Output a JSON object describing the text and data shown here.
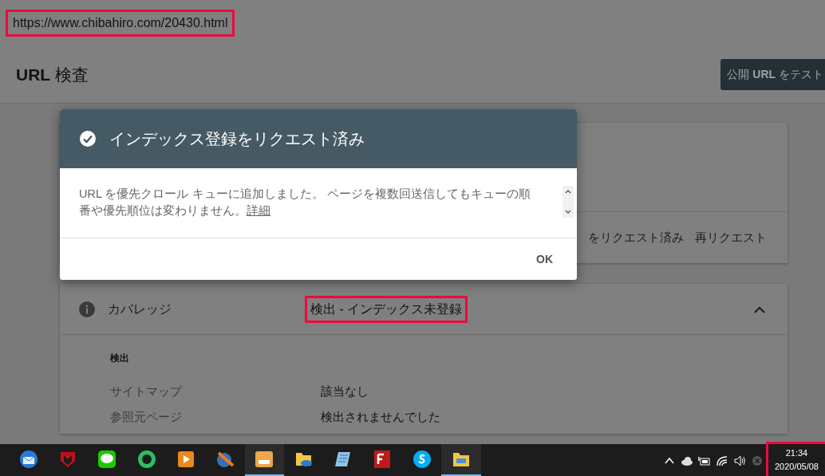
{
  "address_bar": {
    "url": "https://www.chibahiro.com/20430.html",
    "highlighted": true
  },
  "header": {
    "title": "**URL** 検査",
    "test_button": "公開 **URL** をテスト"
  },
  "request_card": {
    "status": "をリクエスト済み",
    "request_again": "再リクエスト"
  },
  "coverage": {
    "label": "カバレッジ",
    "value": "検出 - インデックス未登録",
    "value_highlighted": true,
    "expanded": true,
    "section": "検出",
    "rows": [
      {
        "label": "サイトマップ",
        "value": "該当なし"
      },
      {
        "label": "参照元ページ",
        "value": "検出されませんでした"
      }
    ]
  },
  "dialog": {
    "title": "インデックス登録をリクエスト済み",
    "message": "URL を優先クロール キューに追加しました。 ページを複数回送信してもキューの順番や優先順位は変わりません。",
    "link": "詳細",
    "button": "OK"
  },
  "taskbar": {
    "apps": [
      {
        "kind": "mail",
        "active": false
      },
      {
        "kind": "shield",
        "active": false
      },
      {
        "kind": "chat",
        "active": false
      },
      {
        "kind": "note",
        "active": false
      },
      {
        "kind": "player",
        "active": false
      },
      {
        "kind": "film",
        "active": false
      },
      {
        "kind": "face",
        "active": true
      },
      {
        "kind": "cloud-folder",
        "active": false
      },
      {
        "kind": "notepad",
        "active": false
      },
      {
        "kind": "ftp",
        "active": false
      },
      {
        "kind": "call",
        "active": false
      },
      {
        "kind": "folder",
        "active": true
      }
    ],
    "tray": [
      {
        "kind": "chevron"
      },
      {
        "kind": "cloud"
      },
      {
        "kind": "battery"
      },
      {
        "kind": "wifi"
      },
      {
        "kind": "volume"
      },
      {
        "kind": "error"
      }
    ],
    "clock": {
      "time": "21:34",
      "date": "2020/05/08",
      "highlighted": true
    }
  }
}
